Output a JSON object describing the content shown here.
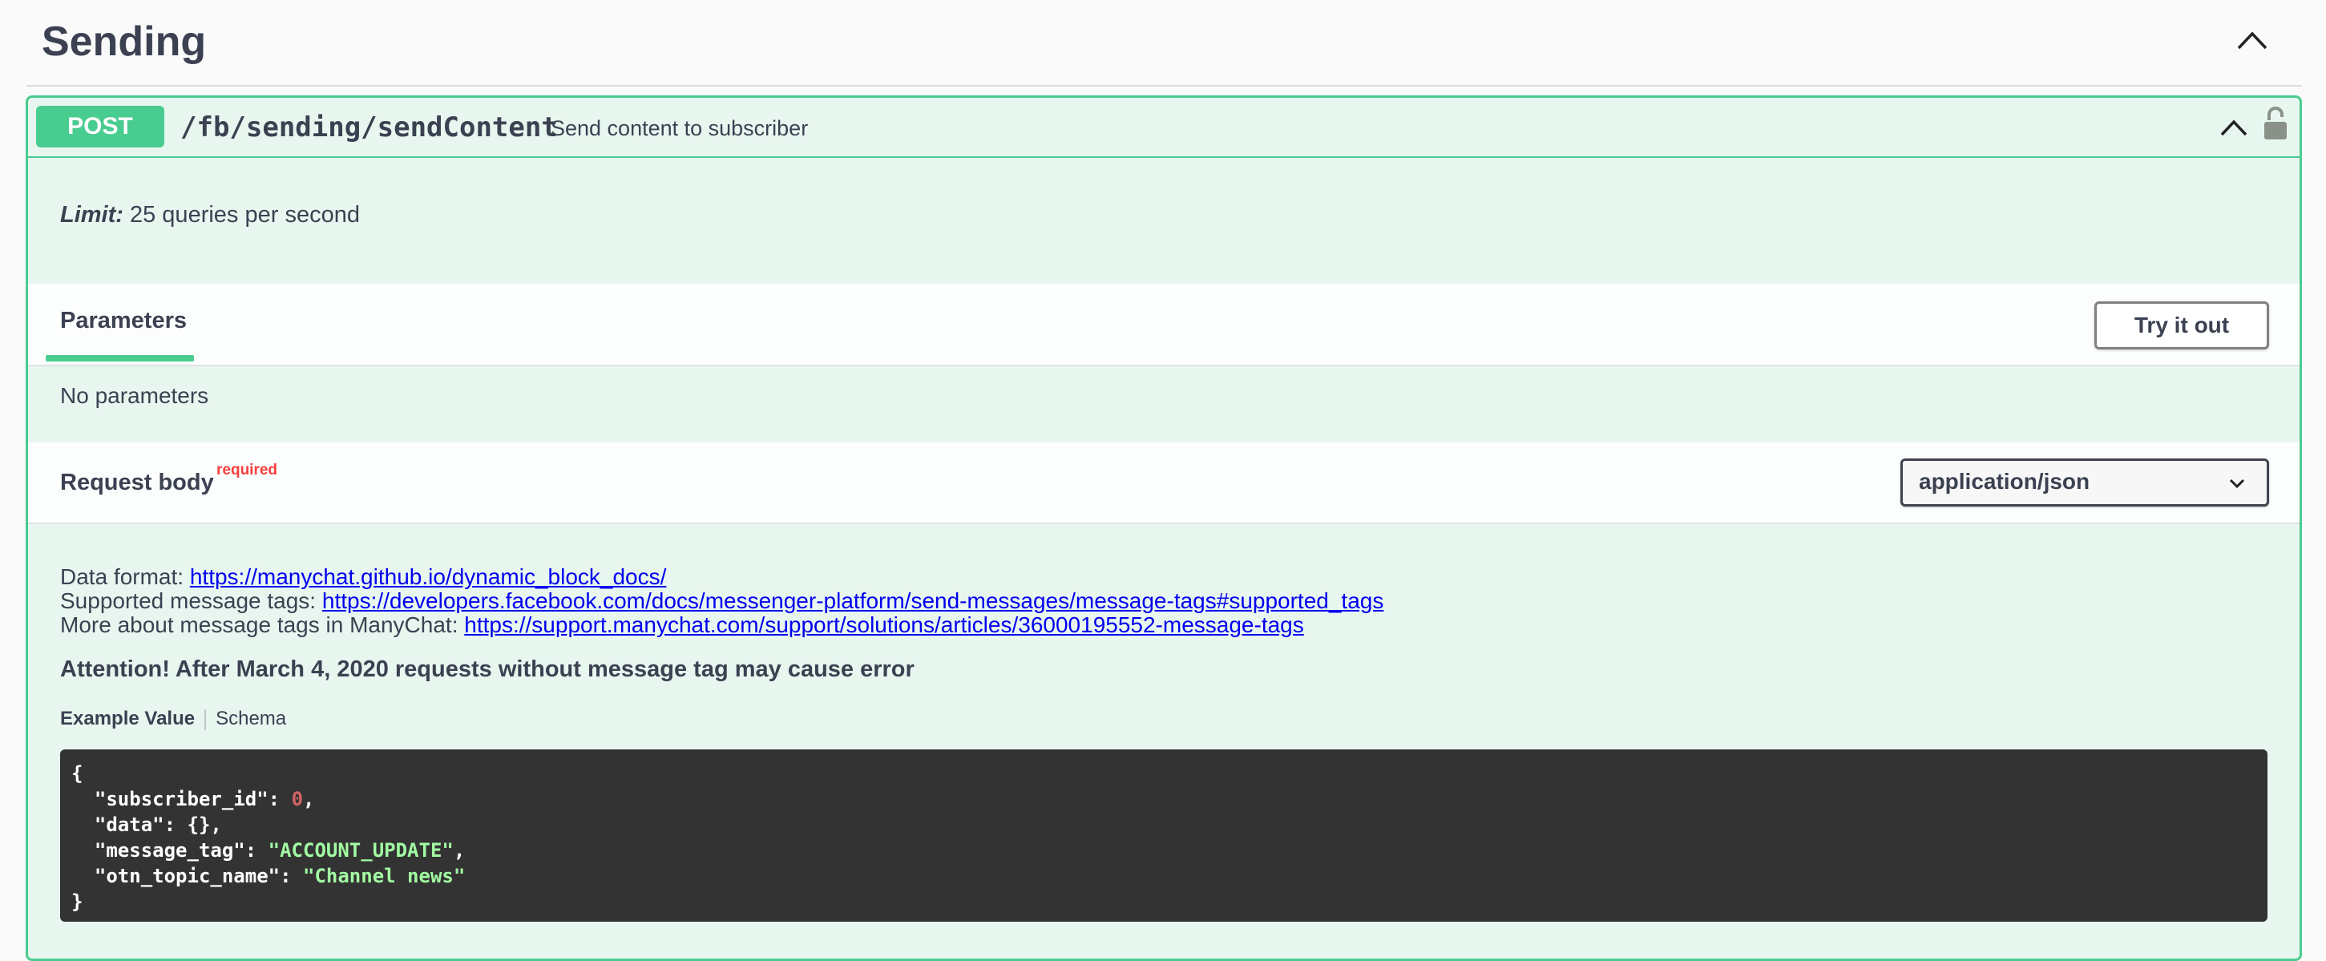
{
  "section": {
    "title": "Sending"
  },
  "operation": {
    "method": "POST",
    "path": "/fb/sending/sendContent",
    "summary": "Send content to subscriber",
    "limit_label": "Limit:",
    "limit_text": " 25 queries per second",
    "tab_parameters": "Parameters",
    "try_it_out": "Try it out",
    "no_parameters": "No parameters",
    "request_body_label": "Request body",
    "required_label": "required",
    "content_type": "application/json",
    "desc": {
      "line1_label": "Data format: ",
      "line1_link": "https://manychat.github.io/dynamic_block_docs/",
      "line2_label": "Supported message tags: ",
      "line2_link": "https://developers.facebook.com/docs/messenger-platform/send-messages/message-tags#supported_tags",
      "line3_label": "More about message tags in ManyChat: ",
      "line3_link": "https://support.manychat.com/support/solutions/articles/36000195552-message-tags"
    },
    "attention": "Attention! After March 4, 2020 requests without message tag may cause error",
    "example_value_tab": "Example Value",
    "schema_tab": "Schema",
    "example": {
      "open": "{",
      "k1": "\"subscriber_id\"",
      "v1": "0",
      "k2": "\"data\"",
      "v2": "{}",
      "k3": "\"message_tag\"",
      "v3": "\"ACCOUNT_UPDATE\"",
      "k4": "\"otn_topic_name\"",
      "v4": "\"Channel news\"",
      "close": "}"
    }
  },
  "icons": {
    "section_toggle": "chevron-up-icon",
    "op_toggle": "chevron-up-icon",
    "lock": "unlocked-lock-icon",
    "select_arrow": "chevron-down-icon"
  },
  "colors": {
    "post_accent": "#49cc90",
    "post_bg": "#e8f6f0",
    "code_bg": "#333333"
  }
}
